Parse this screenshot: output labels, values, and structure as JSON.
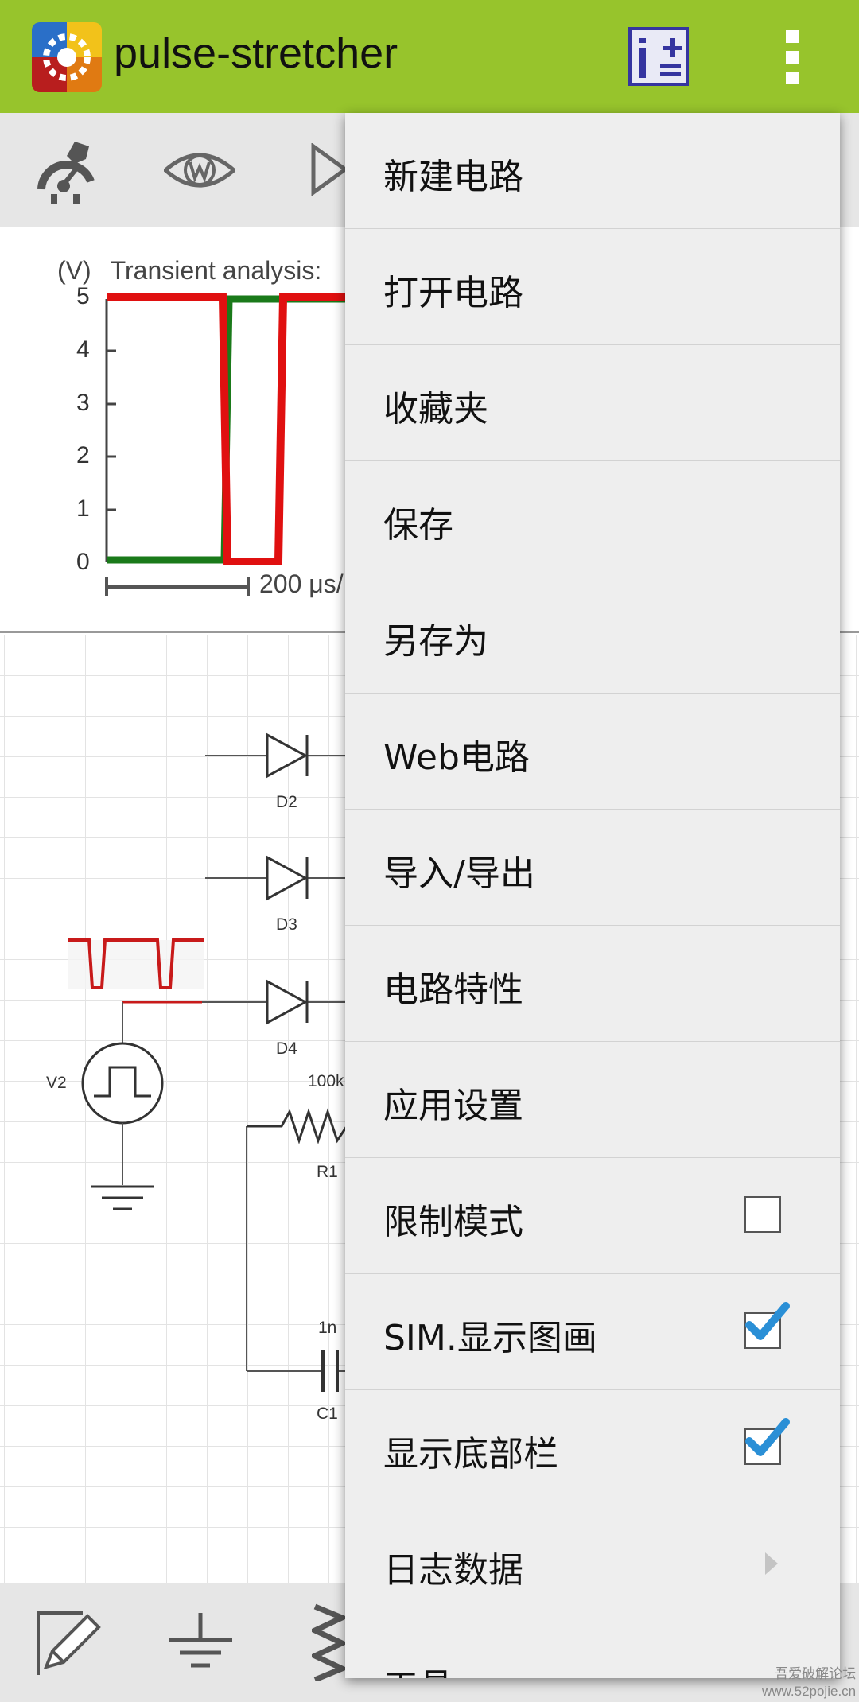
{
  "app": {
    "title": "pulse-stretcher"
  },
  "plot": {
    "ylabel": "(V)",
    "title": "Transient analysis:",
    "yticks": [
      "5",
      "4",
      "3",
      "2",
      "1",
      "0"
    ],
    "scale": "200 μs/"
  },
  "schematic": {
    "labels": {
      "d2": "D2",
      "d3": "D3",
      "d4": "D4",
      "v2": "V2",
      "r1_value": "100k",
      "r1": "R1",
      "c1_value": "1n",
      "c1": "C1"
    }
  },
  "menu": {
    "items": [
      {
        "label": "新建电路"
      },
      {
        "label": "打开电路"
      },
      {
        "label": "收藏夹"
      },
      {
        "label": "保存"
      },
      {
        "label": "另存为"
      },
      {
        "label": "Web电路"
      },
      {
        "label": "导入/导出"
      },
      {
        "label": "电路特性"
      },
      {
        "label": "应用设置"
      },
      {
        "label": "限制模式",
        "checked": false
      },
      {
        "label": "SIM.显示图画",
        "checked": true
      },
      {
        "label": "显示底部栏",
        "checked": true
      },
      {
        "label": "日志数据"
      },
      {
        "label": "工具"
      }
    ]
  },
  "watermark": {
    "line1": "吾爱破解论坛",
    "line2": "www.52pojie.cn"
  },
  "colors": {
    "appbar": "#97c42c",
    "trace_red": "#e01010",
    "trace_green": "#1a7a1a",
    "check_blue": "#2a8fd6"
  },
  "icons": [
    "app-logo-icon",
    "calculator-icon",
    "overflow-icon",
    "wrench-gauge-icon",
    "eye-w-icon",
    "play-icon",
    "pencil-icon",
    "ground-icon",
    "resistor-icon"
  ]
}
